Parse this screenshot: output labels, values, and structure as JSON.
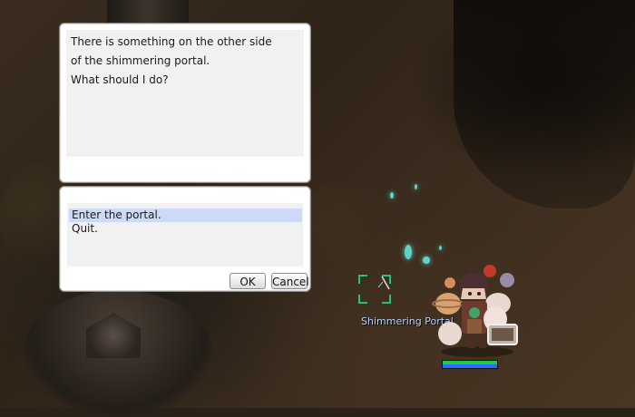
{
  "dialog": {
    "message_lines": [
      "There is something on the other side",
      "of the shimmering portal.",
      "What should I do?"
    ]
  },
  "menu": {
    "options": [
      "Enter the portal.",
      "Quit."
    ],
    "selected_index": 0,
    "ok_label": "OK",
    "cancel_label": "Cancel"
  },
  "npc": {
    "name": "Shimmering Portal"
  },
  "player": {
    "hp_fraction": 1.0,
    "sp_fraction": 1.0
  },
  "colors": {
    "selection": "#cddaf6",
    "npc_name": "#b9d3ff",
    "target_marker": "#27c07a",
    "hp_bar": "#1ec94a",
    "sp_bar": "#2b6bff"
  }
}
